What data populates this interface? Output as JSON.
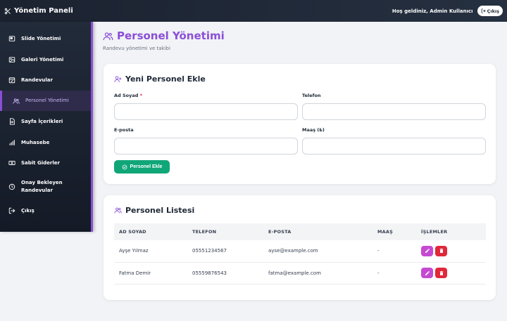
{
  "topbar": {
    "brand_icon": "scissors-icon",
    "brand": "Yönetim Paneli",
    "welcome": "Hoş geldiniz, Admin Kullanıcı",
    "logout_label": "Çıkış",
    "logout_icon": "logout-icon"
  },
  "sidebar": {
    "accent_color": "#8a4fd6",
    "items": [
      {
        "label": "Slide Yönetimi",
        "icon": "slides-icon"
      },
      {
        "label": "Galeri Yönetimi",
        "icon": "gallery-icon"
      },
      {
        "label": "Randevular",
        "icon": "calendar-check-icon"
      },
      {
        "label": "Personel Yönetimi",
        "icon": "users-icon",
        "active": true
      },
      {
        "label": "Sayfa İçerikleri",
        "icon": "document-icon"
      },
      {
        "label": "Muhasebe",
        "icon": "bar-chart-icon"
      },
      {
        "label": "Sabit Giderler",
        "icon": "money-icon"
      },
      {
        "label": "Onay Bekleyen Randevular",
        "icon": "clock-icon"
      },
      {
        "label": "Çıkış",
        "icon": "logout-icon"
      }
    ]
  },
  "page": {
    "title": "Personel Yönetimi",
    "title_color": "#8b4fd8",
    "subtitle": "Randevu yönetimi ve takibi"
  },
  "form": {
    "title": "Yeni Personel Ekle",
    "name_label": "Ad Soyad",
    "required_mark": "*",
    "name_value": "",
    "phone_label": "Telefon",
    "phone_value": "",
    "email_label": "E-posta",
    "email_value": "",
    "salary_label": "Maaş (₺)",
    "salary_value": "",
    "submit_label": "Personel Ekle",
    "submit_color": "#10a678"
  },
  "list": {
    "title": "Personel Listesi",
    "columns": [
      "AD SOYAD",
      "TELEFON",
      "E-POSTA",
      "MAAŞ",
      "İŞLEMLER"
    ],
    "rows": [
      {
        "name": "Ayşe Yılmaz",
        "phone": "05551234567",
        "email": "ayse@example.com",
        "salary": "-"
      },
      {
        "name": "Fatma Demir",
        "phone": "05559876543",
        "email": "fatma@example.com",
        "salary": "-"
      }
    ],
    "edit_color": "#c64ad1",
    "delete_color": "#e0283a"
  }
}
